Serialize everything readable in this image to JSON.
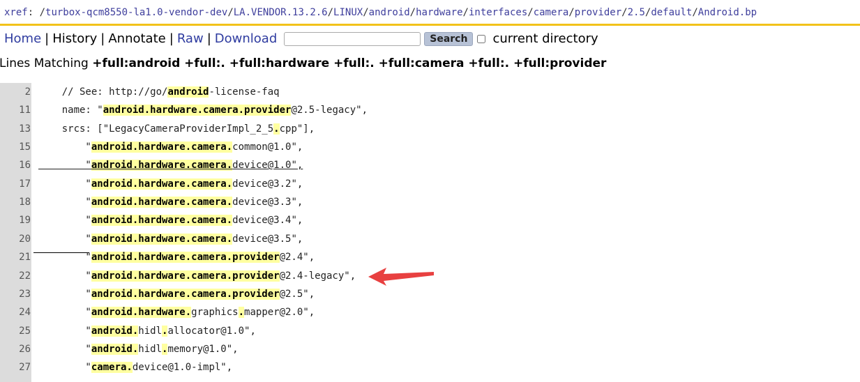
{
  "breadcrumb": {
    "prefix": "xref",
    "separator": ": ",
    "segments": [
      "/turbox-qcm8550-la1.0-vendor-dev",
      "/LA.VENDOR.13.2.6",
      "/LINUX",
      "/android",
      "/hardware",
      "/interfaces",
      "/camera",
      "/provider",
      "/2.5",
      "/default",
      "/Android.bp"
    ]
  },
  "nav": {
    "home": "Home",
    "history": "History",
    "annotate": "Annotate",
    "raw": "Raw",
    "download": "Download",
    "separator": "|",
    "search_value": "",
    "search_button": "Search",
    "current_directory": "current directory"
  },
  "heading": {
    "prefix": "Lines Matching ",
    "query": "+full:android +full:. +full:hardware +full:. +full:camera +full:. +full:provider"
  },
  "lines": [
    {
      "num": "2",
      "parts": [
        [
          "    // See: http://go/",
          0
        ],
        [
          "android",
          1
        ],
        [
          "-license-faq",
          0
        ]
      ]
    },
    {
      "num": "11",
      "parts": [
        [
          "    name: \"",
          0
        ],
        [
          "android.hardware.camera.provider",
          1
        ],
        [
          "@2.5-legacy\",",
          0
        ]
      ]
    },
    {
      "num": "13",
      "parts": [
        [
          "    srcs: [\"LegacyCameraProviderImpl_2_5",
          0
        ],
        [
          ".",
          1
        ],
        [
          "cpp\"],",
          0
        ]
      ]
    },
    {
      "num": "15",
      "parts": [
        [
          "        \"",
          0
        ],
        [
          "android.hardware.camera.",
          1
        ],
        [
          "common@1.0\",",
          0
        ]
      ]
    },
    {
      "num": "16",
      "parts": [
        [
          "        \"",
          0
        ],
        [
          "android.hardware.camera.",
          1
        ],
        [
          "device@1.0\",",
          0
        ]
      ]
    },
    {
      "num": "17",
      "parts": [
        [
          "        \"",
          0
        ],
        [
          "android.hardware.camera.",
          1
        ],
        [
          "device@3.2\",",
          0
        ]
      ]
    },
    {
      "num": "18",
      "parts": [
        [
          "        \"",
          0
        ],
        [
          "android.hardware.camera.",
          1
        ],
        [
          "device@3.3\",",
          0
        ]
      ]
    },
    {
      "num": "19",
      "parts": [
        [
          "        \"",
          0
        ],
        [
          "android.hardware.camera.",
          1
        ],
        [
          "device@3.4\",",
          0
        ]
      ]
    },
    {
      "num": "20",
      "parts": [
        [
          "        \"",
          0
        ],
        [
          "android.hardware.camera.",
          1
        ],
        [
          "device@3.5\",",
          0
        ]
      ]
    },
    {
      "num": "21",
      "parts": [
        [
          "        \"",
          0
        ],
        [
          "android.hardware.camera.provider",
          1
        ],
        [
          "@2.4\",",
          0
        ]
      ]
    },
    {
      "num": "22",
      "parts": [
        [
          "        \"",
          0
        ],
        [
          "android.hardware.camera.provider",
          1
        ],
        [
          "@2.4-legacy\",",
          0
        ]
      ]
    },
    {
      "num": "23",
      "parts": [
        [
          "        \"",
          0
        ],
        [
          "android.hardware.camera.provider",
          1
        ],
        [
          "@2.5\",",
          0
        ]
      ]
    },
    {
      "num": "24",
      "parts": [
        [
          "        \"",
          0
        ],
        [
          "android.hardware.",
          1
        ],
        [
          "graphics",
          0
        ],
        [
          ".",
          1
        ],
        [
          "mapper@2.0\",",
          0
        ]
      ]
    },
    {
      "num": "25",
      "parts": [
        [
          "        \"",
          0
        ],
        [
          "android.",
          1
        ],
        [
          "hidl",
          0
        ],
        [
          ".",
          1
        ],
        [
          "allocator@1.0\",",
          0
        ]
      ]
    },
    {
      "num": "26",
      "parts": [
        [
          "        \"",
          0
        ],
        [
          "android.",
          1
        ],
        [
          "hidl",
          0
        ],
        [
          ".",
          1
        ],
        [
          "memory@1.0\",",
          0
        ]
      ]
    },
    {
      "num": "27",
      "parts": [
        [
          "        \"",
          0
        ],
        [
          "camera.",
          1
        ],
        [
          "device@1.0-impl\",",
          0
        ]
      ]
    }
  ],
  "colors": {
    "accent_bar": "#f2c21a",
    "highlight": "#ffffa0",
    "link": "#3e3e9c",
    "arrow": "#e84040",
    "gutter": "#dcdcdc"
  },
  "icons": {
    "annotation_arrow": "arrow-left-icon"
  }
}
